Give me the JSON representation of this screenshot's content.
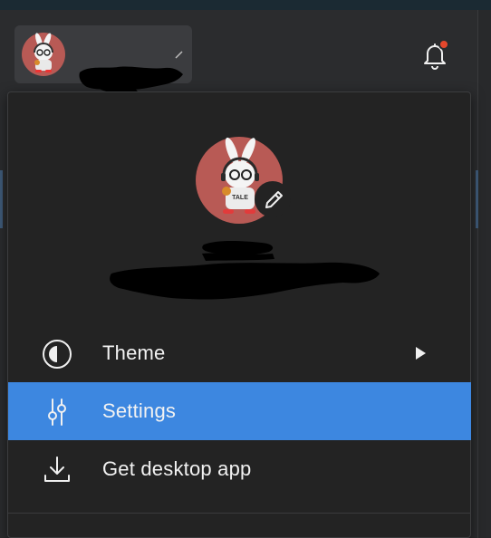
{
  "colors": {
    "app_background": "#2b2c2e",
    "panel_background": "#232323",
    "selected_item": "#3d87e0",
    "notification_dot": "#e5472c",
    "avatar_background": "#b85a55"
  },
  "header": {
    "account_chip": {
      "avatar_icon": "rabbit-avatar-icon",
      "name_redacted": true,
      "caret_icon": "chevron-down-icon"
    },
    "notifications": {
      "icon": "bell-icon",
      "has_unread": true
    }
  },
  "profile": {
    "avatar_icon": "rabbit-avatar-icon",
    "edit_icon": "pencil-icon",
    "name_redacted": true,
    "email_redacted": true
  },
  "menu": {
    "items": [
      {
        "label": "Theme",
        "icon": "half-circle-icon",
        "has_submenu": true,
        "selected": false
      },
      {
        "label": "Settings",
        "icon": "sliders-icon",
        "has_submenu": false,
        "selected": true
      },
      {
        "label": "Get desktop app",
        "icon": "download-icon",
        "has_submenu": false,
        "selected": false
      }
    ]
  }
}
